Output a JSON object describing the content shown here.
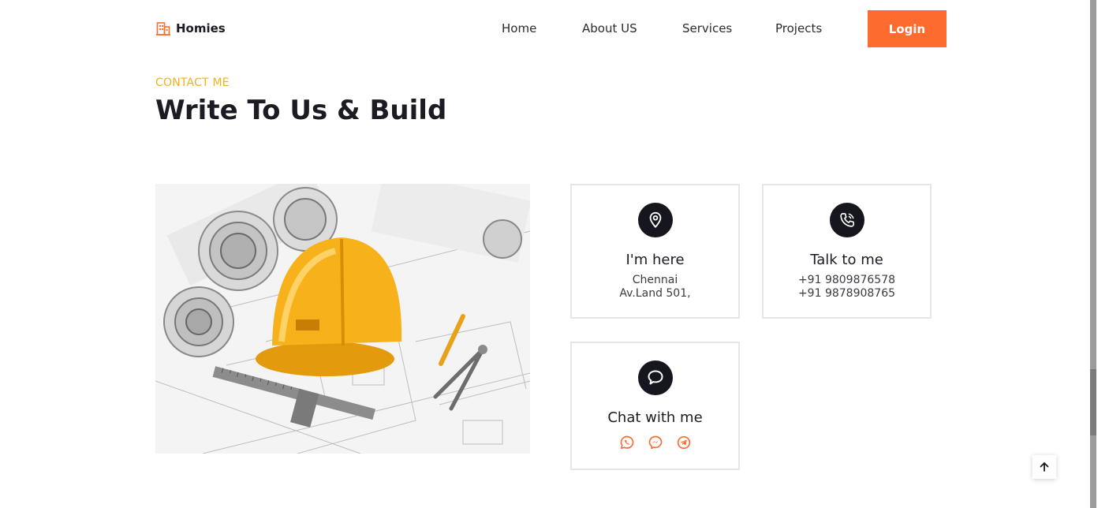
{
  "brand": {
    "name": "Homies",
    "icon": "building-icon"
  },
  "nav": {
    "links": [
      "Home",
      "About US",
      "Services",
      "Projects"
    ],
    "login_label": "Login"
  },
  "section": {
    "eyebrow": "CONTACT ME",
    "title": "Write To Us & Build"
  },
  "image": {
    "icon": "construction-helmet-blueprints-image"
  },
  "cards": {
    "location": {
      "icon": "map-pin-icon",
      "title": "I'm here",
      "lines": [
        "Chennai",
        "Av.Land 501,"
      ]
    },
    "phone": {
      "icon": "phone-icon",
      "title": "Talk to me",
      "lines": [
        "+91 9809876578",
        "+91 9878908765"
      ]
    },
    "chat": {
      "icon": "chat-bubble-icon",
      "title": "Chat with me",
      "socials": [
        "whatsapp-icon",
        "messenger-icon",
        "telegram-icon"
      ]
    }
  },
  "back_to_top": {
    "icon": "arrow-up-icon"
  },
  "colors": {
    "accent": "#fd6b2f",
    "eyebrow": "#f2b01e",
    "dark": "#16161f"
  }
}
